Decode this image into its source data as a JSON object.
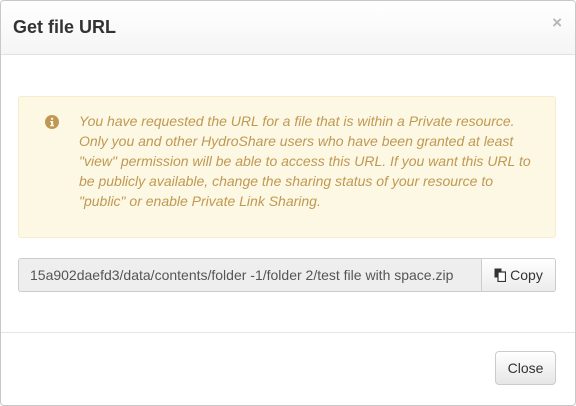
{
  "dialog": {
    "title": "Get file URL",
    "close_glyph": "×"
  },
  "alert": {
    "icon": "info-circle-icon",
    "message": "You have requested the URL for a file that is within a Private resource. Only you and other HydroShare users who have been granted at least \"view\" permission will be able to access this URL. If you want this URL to be publicly available, change the sharing status of your resource to \"public\" or enable Private Link Sharing.",
    "colors": {
      "background": "#fcf8e3",
      "border": "#faebcc",
      "text": "#c09853"
    }
  },
  "url_field": {
    "value": "15a902daefd3/data/contents/folder -1/folder 2/test file with space.zip"
  },
  "copy_button": {
    "icon": "copy-icon",
    "label": "Copy"
  },
  "footer": {
    "close_label": "Close"
  }
}
